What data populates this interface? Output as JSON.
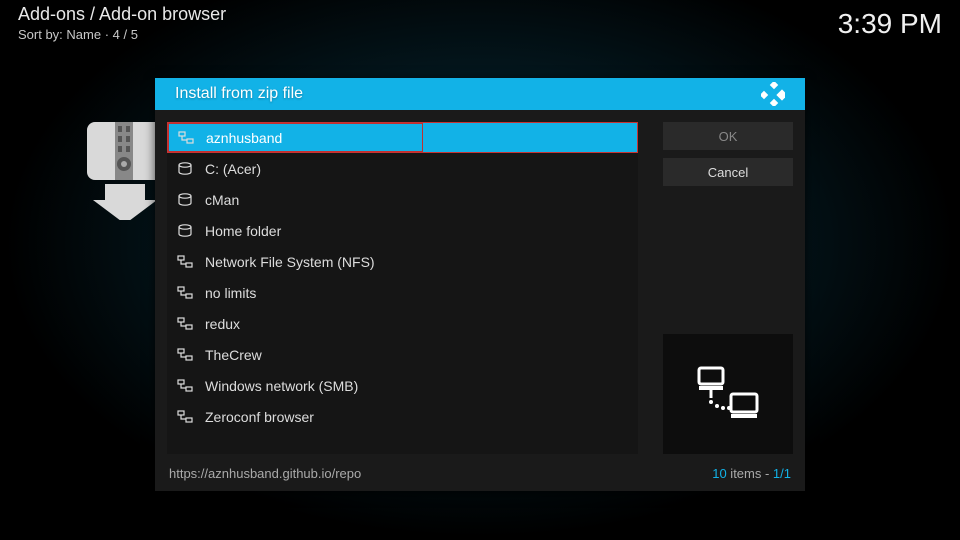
{
  "header": {
    "breadcrumb": "Add-ons / Add-on browser",
    "sort_prefix": "Sort by: ",
    "sort_value": "Name",
    "sort_sep": "  ·  ",
    "page": "4 / 5"
  },
  "clock": "3:39 PM",
  "dialog": {
    "title": "Install from zip file",
    "items": [
      {
        "label": "aznhusband",
        "icon": "net",
        "selected": true
      },
      {
        "label": "C: (Acer)",
        "icon": "disk",
        "selected": false
      },
      {
        "label": "cMan",
        "icon": "disk",
        "selected": false
      },
      {
        "label": "Home folder",
        "icon": "disk",
        "selected": false
      },
      {
        "label": "Network File System (NFS)",
        "icon": "net",
        "selected": false
      },
      {
        "label": "no limits",
        "icon": "net",
        "selected": false
      },
      {
        "label": "redux",
        "icon": "net",
        "selected": false
      },
      {
        "label": "TheCrew",
        "icon": "net",
        "selected": false
      },
      {
        "label": "Windows network (SMB)",
        "icon": "net",
        "selected": false
      },
      {
        "label": "Zeroconf browser",
        "icon": "net",
        "selected": false
      }
    ],
    "ok_label": "OK",
    "cancel_label": "Cancel",
    "footer_path": "https://aznhusband.github.io/repo",
    "footer_count": "10",
    "footer_items_word": " items - ",
    "footer_page": "1/1"
  }
}
